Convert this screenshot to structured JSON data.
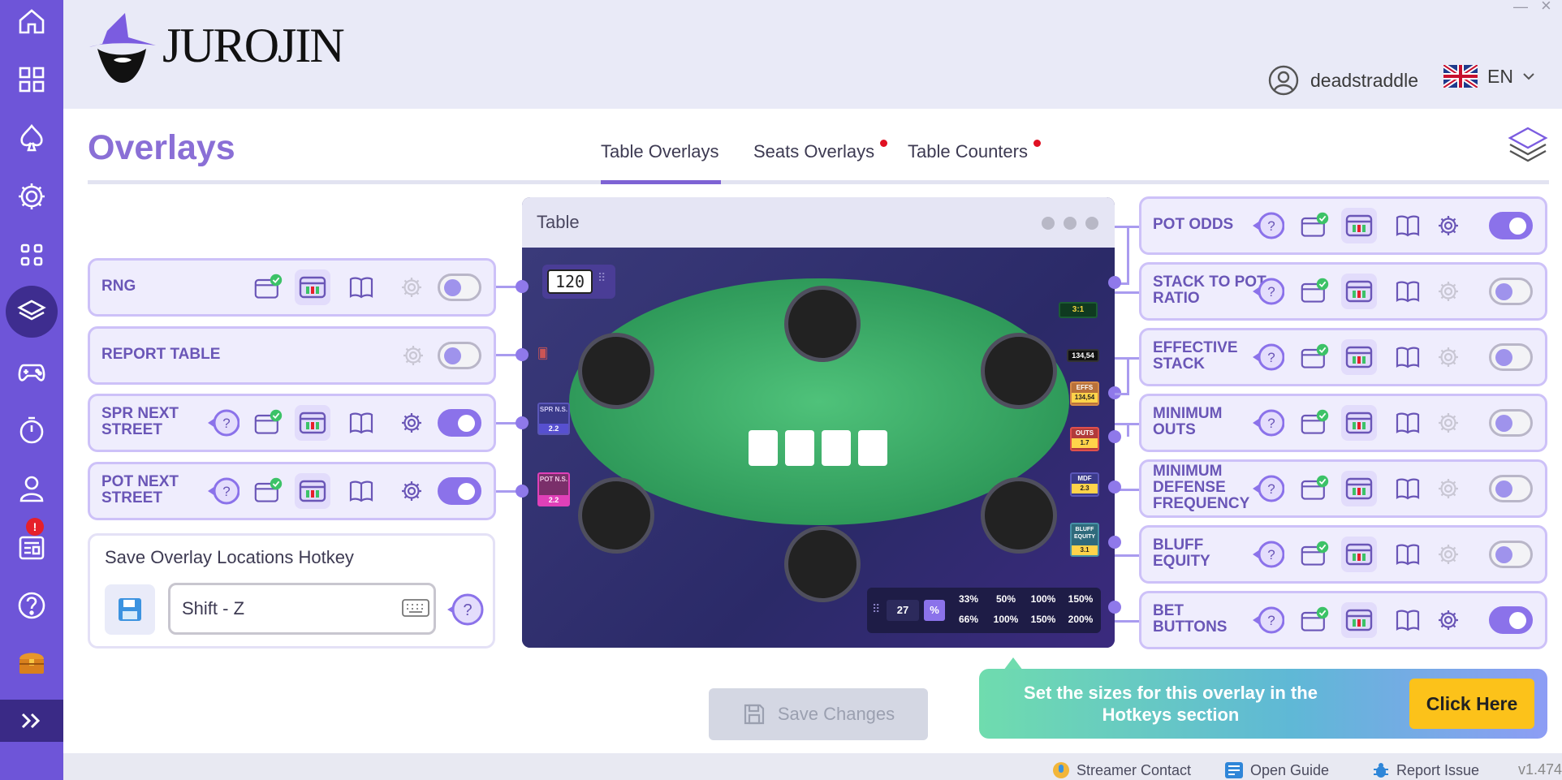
{
  "app": {
    "brand": "JUROJIN"
  },
  "header": {
    "username": "deadstraddle",
    "language": "EN"
  },
  "page": {
    "title": "Overlays"
  },
  "tabs": [
    {
      "label": "Table Overlays",
      "active": true
    },
    {
      "label": "Seats Overlays",
      "notification": true
    },
    {
      "label": "Table Counters",
      "notification": true
    }
  ],
  "sidebar": {
    "items": [
      "home-icon",
      "dashboard-icon",
      "spade-icon",
      "settings-icon",
      "apps-icon",
      "layers-icon",
      "gamepad-icon",
      "timer-icon",
      "user-icon",
      "news-icon",
      "help-icon",
      "chest-icon"
    ],
    "active": "layers-icon",
    "news_badge": "!"
  },
  "left_overlays": [
    {
      "label": "RNG",
      "enabled": false
    },
    {
      "label": "REPORT TABLE",
      "enabled": false
    },
    {
      "label": "SPR NEXT STREET",
      "enabled": true
    },
    {
      "label": "POT NEXT STREET",
      "enabled": true
    }
  ],
  "right_overlays": [
    {
      "label": "POT ODDS",
      "enabled": true
    },
    {
      "label": "STACK TO POT RATIO",
      "enabled": false
    },
    {
      "label": "EFFECTIVE STACK",
      "enabled": false
    },
    {
      "label": "MINIMUM OUTS",
      "enabled": false
    },
    {
      "label": "MINIMUM DEFENSE FREQUENCY",
      "enabled": false
    },
    {
      "label": "BLUFF EQUITY",
      "enabled": false
    },
    {
      "label": "BET BUTTONS",
      "enabled": true
    }
  ],
  "table_preview": {
    "title": "Table",
    "rng_value": "120",
    "pot_odds": "3:1",
    "spr_value": "134,54",
    "effs_label": "EFFS",
    "effs_value": "134,54",
    "outs_label": "OUTS",
    "outs_value": "1.7",
    "mdf_label": "MDF",
    "mdf_value": "2.3",
    "bluff_label": "BLUFF EQUITY",
    "bluff_value": "3.1",
    "spr_ns_label": "SPR N.S.",
    "spr_ns_value": "2.2",
    "pot_ns_label": "POT N.S.",
    "pot_ns_value": "2.2",
    "bet_input": "27",
    "bet_unit": "%",
    "bet_sizes_row1": [
      "33%",
      "50%",
      "100%",
      "150%"
    ],
    "bet_sizes_row2": [
      "66%",
      "100%",
      "150%",
      "200%"
    ]
  },
  "hotkey": {
    "title": "Save Overlay Locations Hotkey",
    "value": "Shift - Z"
  },
  "save_button": "Save Changes",
  "banner": {
    "text": "Set the sizes for this overlay in the Hotkeys section",
    "button": "Click Here"
  },
  "footer": {
    "streamer": "Streamer Contact",
    "guide": "Open Guide",
    "report": "Report Issue",
    "version": "v1.474"
  },
  "colors": {
    "brand": "#6e55d8",
    "accent": "#8b72ea",
    "notification": "#e01022",
    "cta": "#fcc21a"
  }
}
